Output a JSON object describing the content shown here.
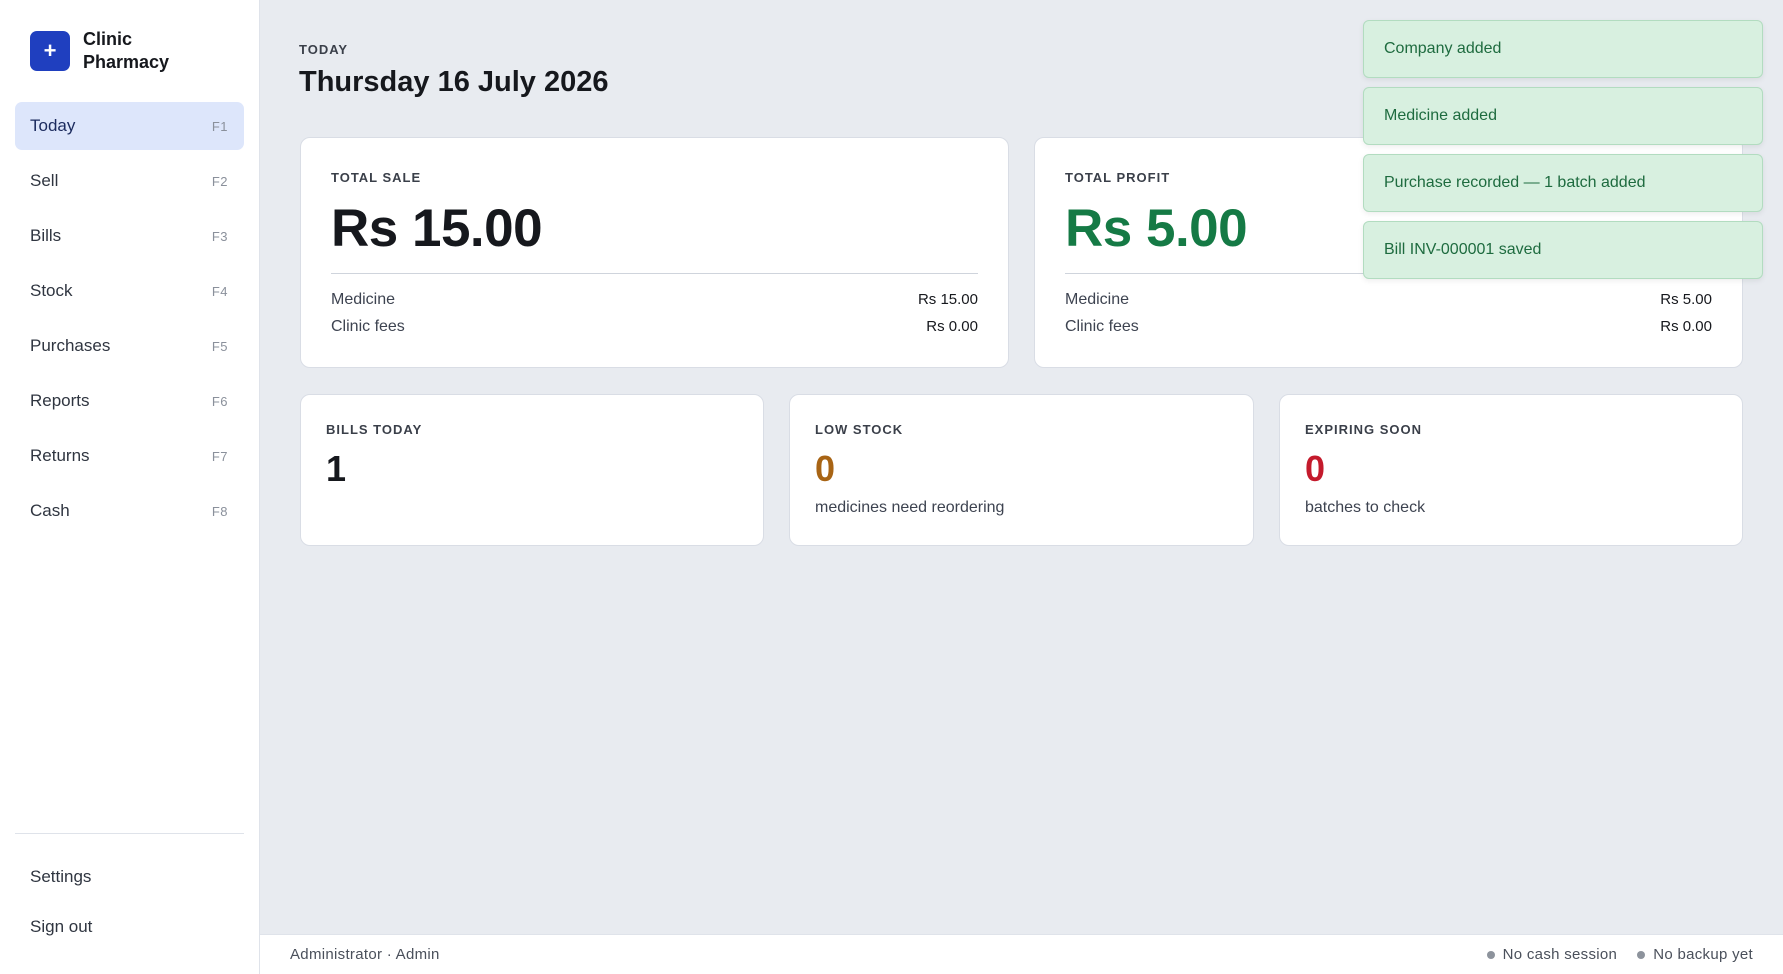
{
  "brand": {
    "logo_glyph": "+",
    "name": "Clinic Pharmacy"
  },
  "nav": {
    "items": [
      {
        "label": "Today",
        "key": "F1"
      },
      {
        "label": "Sell",
        "key": "F2"
      },
      {
        "label": "Bills",
        "key": "F3"
      },
      {
        "label": "Stock",
        "key": "F4"
      },
      {
        "label": "Purchases",
        "key": "F5"
      },
      {
        "label": "Reports",
        "key": "F6"
      },
      {
        "label": "Returns",
        "key": "F7"
      },
      {
        "label": "Cash",
        "key": "F8"
      }
    ],
    "settings": "Settings",
    "sign_out": "Sign out"
  },
  "header": {
    "eyebrow": "TODAY",
    "date": "Thursday 16 July 2026"
  },
  "total_sale": {
    "label": "TOTAL SALE",
    "amount": "Rs 15.00",
    "medicine_label": "Medicine",
    "medicine_value": "Rs 15.00",
    "fees_label": "Clinic fees",
    "fees_value": "Rs 0.00"
  },
  "total_profit": {
    "label": "TOTAL PROFIT",
    "amount": "Rs 5.00",
    "medicine_label": "Medicine",
    "medicine_value": "Rs 5.00",
    "fees_label": "Clinic fees",
    "fees_value": "Rs 0.00"
  },
  "bills_today": {
    "label": "BILLS TODAY",
    "value": "1"
  },
  "low_stock": {
    "label": "LOW STOCK",
    "value": "0",
    "sub": "medicines need reordering"
  },
  "expiring": {
    "label": "EXPIRING SOON",
    "value": "0",
    "sub": "batches to check"
  },
  "toasts": [
    "Company added",
    "Medicine added",
    "Purchase recorded — 1 batch added",
    "Bill INV-000001 saved"
  ],
  "footer": {
    "user": "Administrator · Admin",
    "cash_status": "No cash session",
    "backup_status": "No backup yet"
  },
  "colors": {
    "accent": "#1f3fbf",
    "profit": "#157a45",
    "low_stock": "#a86414",
    "expiring": "#c41a2c",
    "toast_bg": "#d8f0e0"
  }
}
